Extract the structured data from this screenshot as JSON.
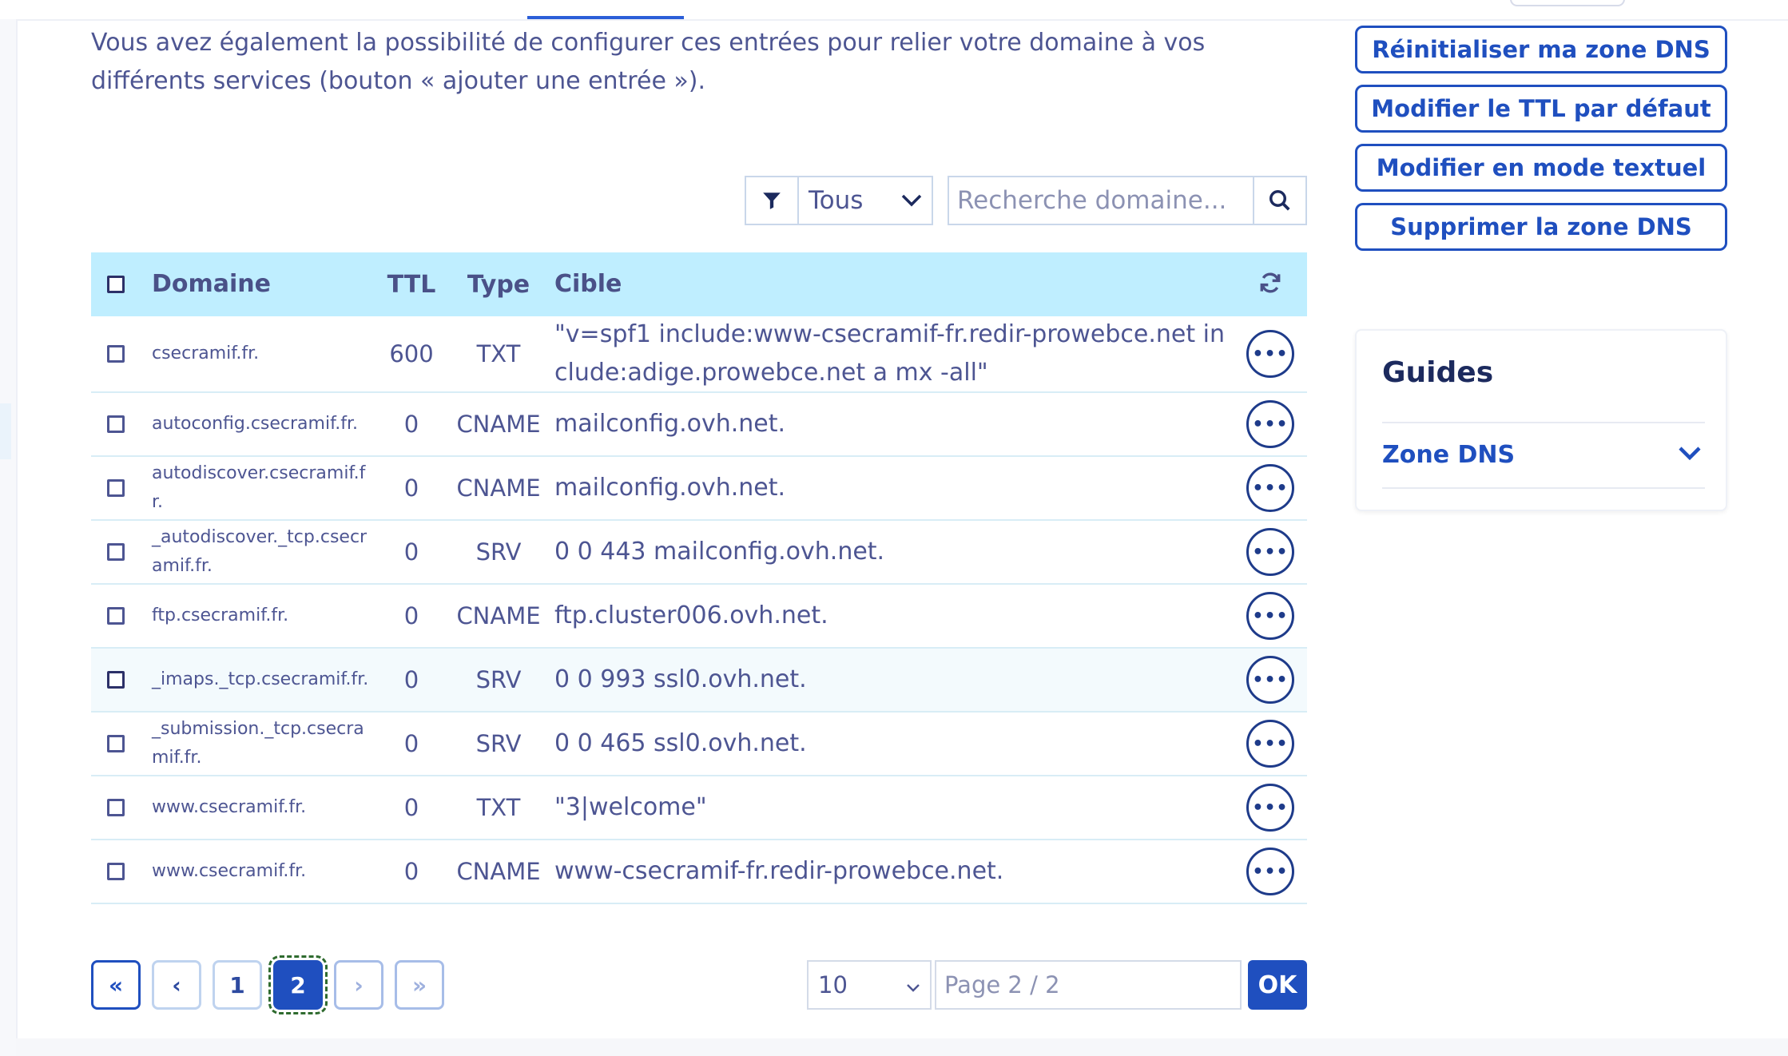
{
  "intro_text": "Vous avez également la possibilité de configurer ces entrées pour relier votre domaine à vos différents services (bouton « ajouter une entrée »).",
  "filter": {
    "selected": "Tous"
  },
  "search": {
    "placeholder": "Recherche domaine..."
  },
  "table": {
    "headers": {
      "domain": "Domaine",
      "ttl": "TTL",
      "type": "Type",
      "target": "Cible"
    },
    "rows": [
      {
        "domain": "csecramif.fr.",
        "ttl": "600",
        "type": "TXT",
        "target": "\"v=spf1 include:www-csecramif-fr.redir-prowebce.net include:adige.prowebce.net a mx -all\""
      },
      {
        "domain": "autoconfig.csecramif.fr.",
        "ttl": "0",
        "type": "CNAME",
        "target": "mailconfig.ovh.net."
      },
      {
        "domain": "autodiscover.csecramif.fr.",
        "ttl": "0",
        "type": "CNAME",
        "target": "mailconfig.ovh.net."
      },
      {
        "domain": "_autodiscover._tcp.csecramif.fr.",
        "ttl": "0",
        "type": "SRV",
        "target": "0 0 443 mailconfig.ovh.net."
      },
      {
        "domain": "ftp.csecramif.fr.",
        "ttl": "0",
        "type": "CNAME",
        "target": "ftp.cluster006.ovh.net."
      },
      {
        "domain": "_imaps._tcp.csecramif.fr.",
        "ttl": "0",
        "type": "SRV",
        "target": "0 0 993 ssl0.ovh.net."
      },
      {
        "domain": "_submission._tcp.csecramif.fr.",
        "ttl": "0",
        "type": "SRV",
        "target": "0 0 465 ssl0.ovh.net."
      },
      {
        "domain": "www.csecramif.fr.",
        "ttl": "0",
        "type": "TXT",
        "target": "\"3|welcome\""
      },
      {
        "domain": "www.csecramif.fr.",
        "ttl": "0",
        "type": "CNAME",
        "target": "www-csecramif-fr.redir-prowebce.net."
      }
    ]
  },
  "actions_button_label": "•••",
  "pagination": {
    "first": "«",
    "prev": "‹",
    "pages": [
      "1",
      "2"
    ],
    "current": "2",
    "next": "›",
    "last": "»",
    "per_page": "10",
    "page_input_placeholder": "Page 2 / 2",
    "ok": "OK"
  },
  "sidebar": {
    "buttons": [
      "Réinitialiser ma zone DNS",
      "Modifier le TTL par défaut",
      "Modifier en mode textuel",
      "Supprimer la zone DNS"
    ],
    "guides": {
      "title": "Guides",
      "item": "Zone DNS"
    }
  },
  "colors": {
    "primary": "#1f4fbf",
    "header_bg": "#bfeeff",
    "text": "#4d5592"
  }
}
